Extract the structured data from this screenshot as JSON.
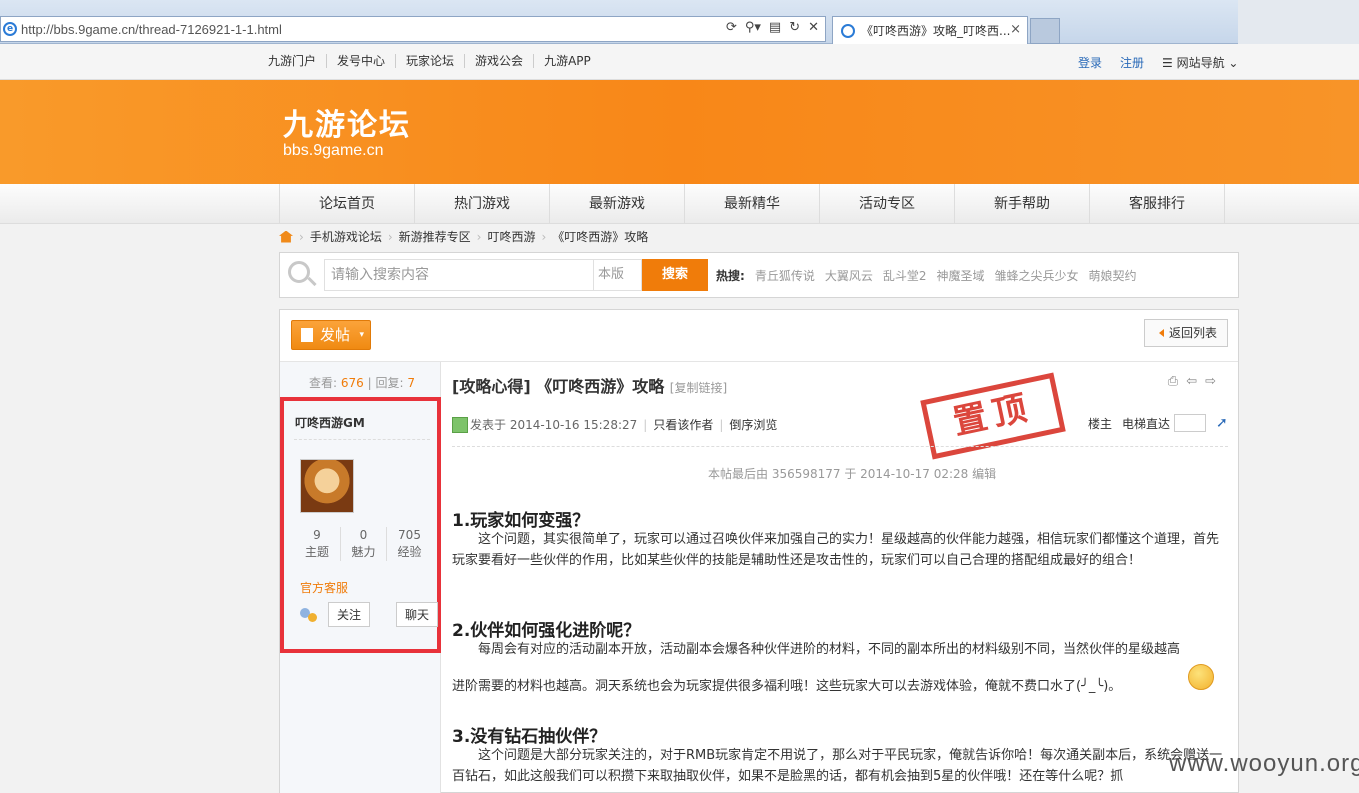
{
  "browser": {
    "url": "http://bbs.9game.cn/thread-7126921-1-1.html",
    "tab_title": "《叮咚西游》攻略_叮咚西...",
    "tab_close": "×",
    "toolbar_icons": [
      "refresh-icon",
      "search-icon",
      "compat-icon",
      "reload-icon",
      "stop-icon"
    ]
  },
  "topbar": {
    "links": [
      "九游门户",
      "发号中心",
      "玩家论坛",
      "游戏公会",
      "九游APP"
    ],
    "login": "登录",
    "register": "注册",
    "site_nav": "☰ 网站导航 ⌄"
  },
  "banner": {
    "logo_cn": "九游论坛",
    "logo_en": "bbs.9game.cn"
  },
  "mainnav": {
    "items": [
      "论坛首页",
      "热门游戏",
      "最新游戏",
      "最新精华",
      "活动专区",
      "新手帮助",
      "客服排行"
    ]
  },
  "breadcrumb": {
    "items": [
      "手机游戏论坛",
      "新游推荐专区",
      "叮咚西游",
      "《叮咚西游》攻略"
    ],
    "sep": "›"
  },
  "search": {
    "placeholder": "请输入搜索内容",
    "scope": "本版",
    "button": "搜索",
    "hot_label": "热搜:",
    "hot_terms": [
      "青丘狐传说",
      "大翼风云",
      "乱斗堂2",
      "神魔圣域",
      "雏蜂之尖兵少女",
      "萌娘契约"
    ]
  },
  "post": {
    "post_button": "发帖",
    "back_button": "返回列表",
    "views_label": "查看:",
    "views": "676",
    "replies_label": "回复:",
    "replies": "7",
    "stats_sep": "|",
    "author": "叮咚西游GM",
    "author_stats": [
      {
        "value": "9",
        "label": "主题"
      },
      {
        "value": "0",
        "label": "魅力"
      },
      {
        "value": "705",
        "label": "经验"
      }
    ],
    "author_group": "官方客服",
    "follow": "关注",
    "chat": "聊天",
    "title": "[攻略心得] 《叮咚西游》攻略",
    "copy_link": "[复制链接]",
    "posted_at": "发表于 2014-10-16 15:28:27",
    "only_author": "只看该作者",
    "reverse": "倒序浏览",
    "floor_label": "楼主",
    "elevator": "电梯直达",
    "stamp": "置顶",
    "edited": "本帖最后由 356598177 于 2014-10-17 02:28 编辑",
    "sections": [
      {
        "heading": "1.玩家如何变强？",
        "body": "这个问题，其实很简单了，玩家可以通过召唤伙伴来加强自己的实力！星级越高的伙伴能力越强，相信玩家们都懂这个道理，首先玩家要看好一些伙伴的作用，比如某些伙伴的技能是辅助性还是攻击性的，玩家们可以自己合理的搭配组成最好的组合！"
      },
      {
        "heading": "2.伙伴如何强化进阶呢？",
        "body": "每周会有对应的活动副本开放，活动副本会爆各种伙伴进阶的材料，不同的副本所出的材料级别不同，当然伙伴的星级越高",
        "body2": "进阶需要的材料也越高。洞天系统也会为玩家提供很多福利哦！这些玩家大可以去游戏体验，俺就不费口水了(╯_╰)。"
      },
      {
        "heading": "3.没有钻石抽伙伴？",
        "body": "这个问题是大部分玩家关注的，对于RMB玩家肯定不用说了，那么对于平民玩家，俺就告诉你哈！每次通关副本后，系统会赠送一百钻石，如此这般我们可以积攒下来取抽取伙伴，如果不是脸黑的话，都有机会抽到5星的伙伴哦！还在等什么呢？抓"
      }
    ]
  },
  "watermark": "www.wooyun.org"
}
